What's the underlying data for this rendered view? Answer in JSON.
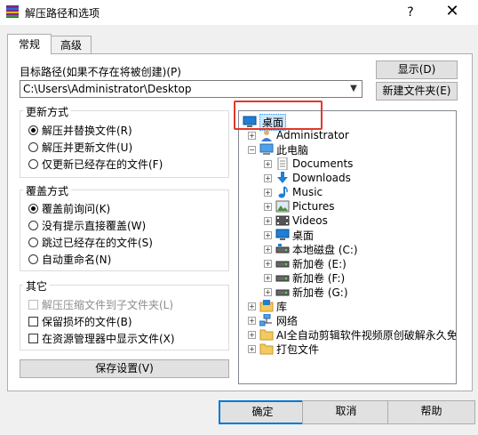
{
  "window": {
    "title": "解压路径和选项",
    "help_glyph": "?",
    "close_glyph": "✕"
  },
  "tabs": [
    {
      "label": "常规",
      "active": true
    },
    {
      "label": "高级",
      "active": false
    }
  ],
  "target_path": {
    "label": "目标路径(如果不存在将被创建)(P)",
    "value": "C:\\Users\\Administrator\\Desktop",
    "show_button": "显示(D)",
    "new_folder_button": "新建文件夹(E)"
  },
  "update_mode": {
    "title": "更新方式",
    "options": [
      {
        "label": "解压并替换文件(R)",
        "selected": true
      },
      {
        "label": "解压并更新文件(U)",
        "selected": false
      },
      {
        "label": "仅更新已经存在的文件(F)",
        "selected": false
      }
    ]
  },
  "overwrite_mode": {
    "title": "覆盖方式",
    "options": [
      {
        "label": "覆盖前询问(K)",
        "selected": true
      },
      {
        "label": "没有提示直接覆盖(W)",
        "selected": false
      },
      {
        "label": "跳过已经存在的文件(S)",
        "selected": false
      },
      {
        "label": "自动重命名(N)",
        "selected": false
      }
    ]
  },
  "misc": {
    "title": "其它",
    "options": [
      {
        "label": "解压压缩文件到子文件夹(L)",
        "checked": false,
        "disabled": true
      },
      {
        "label": "保留损坏的文件(B)",
        "checked": false,
        "disabled": false
      },
      {
        "label": "在资源管理器中显示文件(X)",
        "checked": false,
        "disabled": false
      }
    ]
  },
  "save_settings_button": "保存设置(V)",
  "tree": {
    "nodes": [
      {
        "label": "桌面",
        "icon": "desktop-icon",
        "selected": true
      },
      {
        "label": "Administrator",
        "icon": "user-icon"
      },
      {
        "label": "此电脑",
        "icon": "computer-icon"
      },
      {
        "label": "Documents",
        "icon": "documents-icon"
      },
      {
        "label": "Downloads",
        "icon": "downloads-icon"
      },
      {
        "label": "Music",
        "icon": "music-icon"
      },
      {
        "label": "Pictures",
        "icon": "pictures-icon"
      },
      {
        "label": "Videos",
        "icon": "videos-icon"
      },
      {
        "label": "桌面",
        "icon": "desktop-icon"
      },
      {
        "label": "本地磁盘 (C:)",
        "icon": "drive-icon"
      },
      {
        "label": "新加卷 (E:)",
        "icon": "drive-icon"
      },
      {
        "label": "新加卷 (F:)",
        "icon": "drive-icon"
      },
      {
        "label": "新加卷 (G:)",
        "icon": "drive-icon"
      },
      {
        "label": "库",
        "icon": "library-icon"
      },
      {
        "label": "网络",
        "icon": "network-icon"
      },
      {
        "label": "AI全自动剪辑软件视频原创破解永久免",
        "icon": "folder-icon"
      },
      {
        "label": "打包文件",
        "icon": "folder-icon"
      }
    ]
  },
  "footer": {
    "ok": "确定",
    "cancel": "取消",
    "help": "帮助"
  },
  "colors": {
    "accent": "#0078d7",
    "highlight_box": "#e0392b",
    "selection": "#cce8ff",
    "dialog_bg": "#f0f0f0"
  }
}
